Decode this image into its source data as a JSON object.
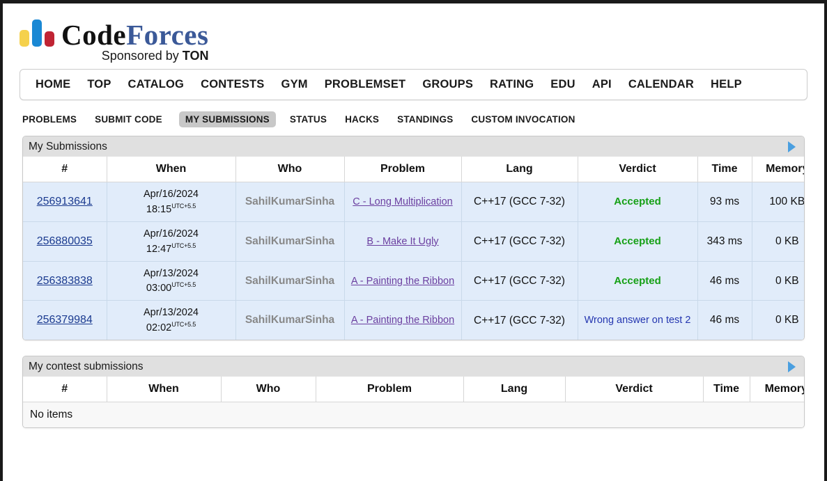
{
  "brand": {
    "name_code": "Code",
    "name_forces": "Forces",
    "sponsor_prefix": "Sponsored by ",
    "sponsor_name": "TON",
    "colors": {
      "bar_yellow": "#f5d14c",
      "bar_blue": "#1a88d4",
      "bar_red": "#c02434",
      "forces_blue": "#3b5998"
    }
  },
  "main_nav": {
    "items": [
      {
        "label": "HOME"
      },
      {
        "label": "TOP"
      },
      {
        "label": "CATALOG"
      },
      {
        "label": "CONTESTS"
      },
      {
        "label": "GYM"
      },
      {
        "label": "PROBLEMSET"
      },
      {
        "label": "GROUPS"
      },
      {
        "label": "RATING"
      },
      {
        "label": "EDU"
      },
      {
        "label": "API"
      },
      {
        "label": "CALENDAR"
      },
      {
        "label": "HELP"
      }
    ]
  },
  "sub_nav": {
    "items": [
      {
        "label": "PROBLEMS",
        "active": false
      },
      {
        "label": "SUBMIT CODE",
        "active": false
      },
      {
        "label": "MY SUBMISSIONS",
        "active": true
      },
      {
        "label": "STATUS",
        "active": false
      },
      {
        "label": "HACKS",
        "active": false
      },
      {
        "label": "STANDINGS",
        "active": false
      },
      {
        "label": "CUSTOM INVOCATION",
        "active": false
      }
    ]
  },
  "my_submissions": {
    "caption": "My Submissions",
    "expand_icon": "play-triangle-icon",
    "columns": [
      "#",
      "When",
      "Who",
      "Problem",
      "Lang",
      "Verdict",
      "Time",
      "Memory"
    ],
    "rows": [
      {
        "id": "256913641",
        "when_date": "Apr/16/2024",
        "when_time": "18:15",
        "when_tz": "UTC+5.5",
        "who": "SahilKumarSinha",
        "problem": "C - Long Multiplication",
        "lang": "C++17 (GCC 7-32)",
        "verdict": "Accepted",
        "verdict_type": "accepted",
        "time": "93 ms",
        "memory": "100 KB"
      },
      {
        "id": "256880035",
        "when_date": "Apr/16/2024",
        "when_time": "12:47",
        "when_tz": "UTC+5.5",
        "who": "SahilKumarSinha",
        "problem": "B - Make It Ugly",
        "lang": "C++17 (GCC 7-32)",
        "verdict": "Accepted",
        "verdict_type": "accepted",
        "time": "343 ms",
        "memory": "0 KB"
      },
      {
        "id": "256383838",
        "when_date": "Apr/13/2024",
        "when_time": "03:00",
        "when_tz": "UTC+5.5",
        "who": "SahilKumarSinha",
        "problem": "A - Painting the Ribbon",
        "lang": "C++17 (GCC 7-32)",
        "verdict": "Accepted",
        "verdict_type": "accepted",
        "time": "46 ms",
        "memory": "0 KB"
      },
      {
        "id": "256379984",
        "when_date": "Apr/13/2024",
        "when_time": "02:02",
        "when_tz": "UTC+5.5",
        "who": "SahilKumarSinha",
        "problem": "A - Painting the Ribbon",
        "lang": "C++17 (GCC 7-32)",
        "verdict": "Wrong answer on test 2",
        "verdict_type": "wrong",
        "time": "46 ms",
        "memory": "0 KB"
      }
    ]
  },
  "contest_submissions": {
    "caption": "My contest submissions",
    "expand_icon": "play-triangle-icon",
    "columns": [
      "#",
      "When",
      "Who",
      "Problem",
      "Lang",
      "Verdict",
      "Time",
      "Memory"
    ],
    "empty_text": "No items"
  }
}
